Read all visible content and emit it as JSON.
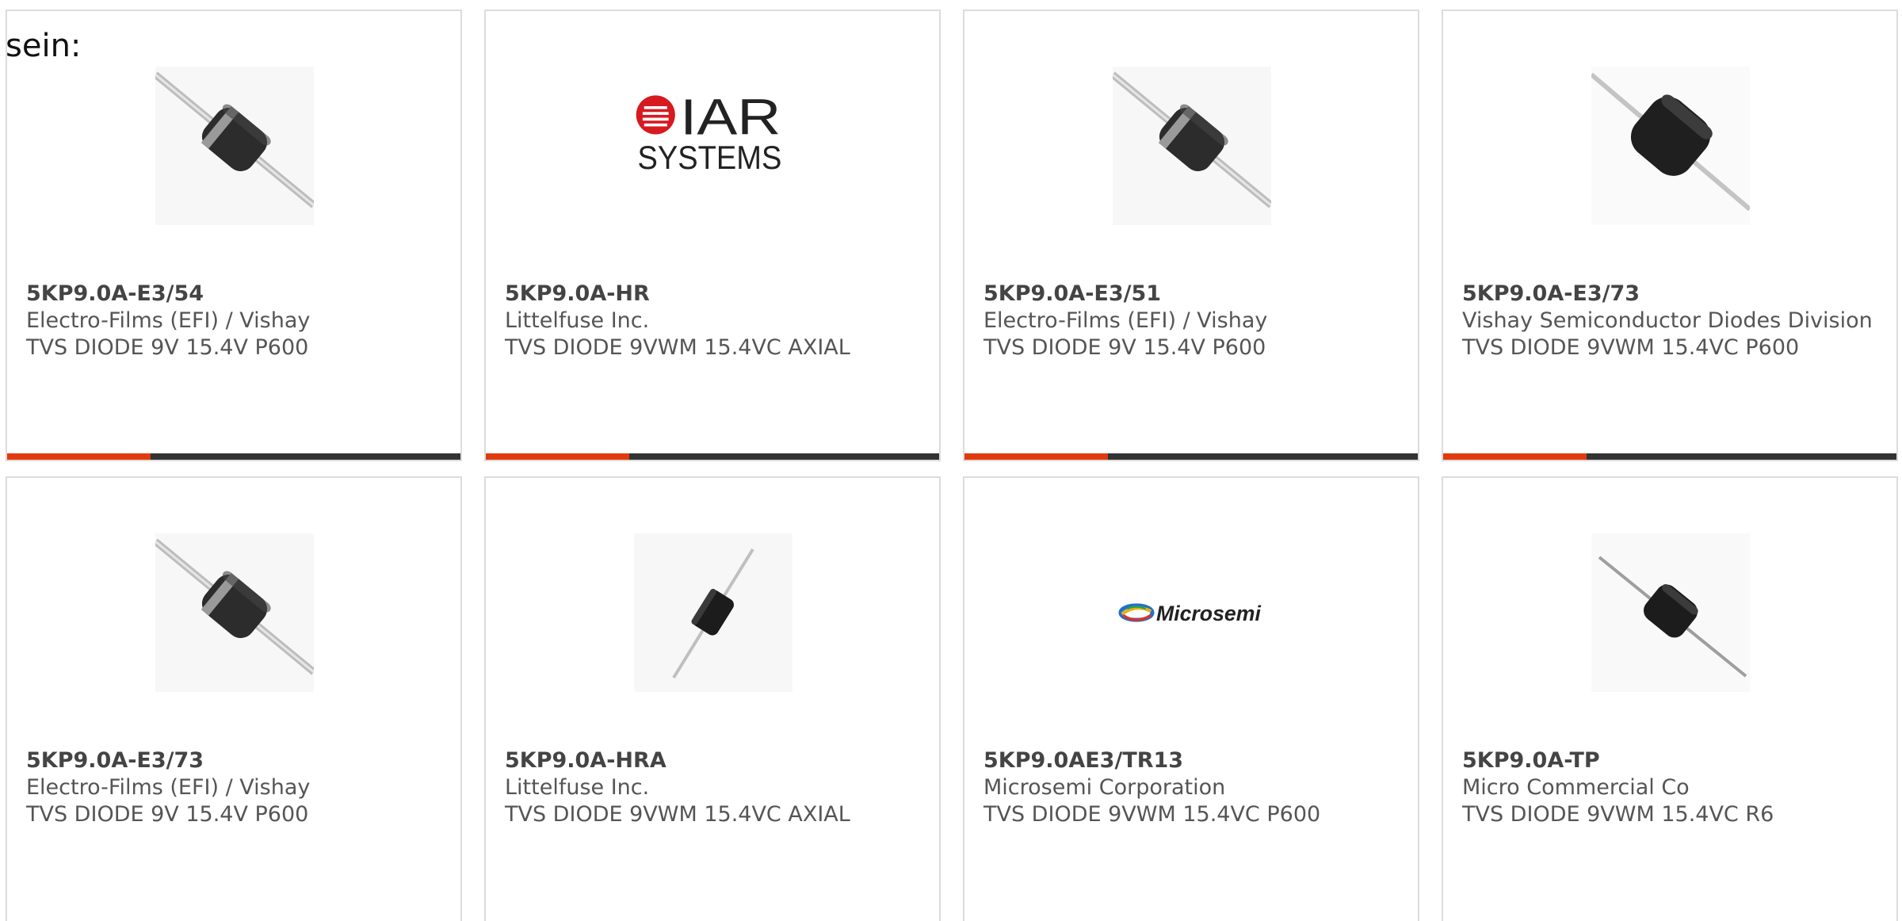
{
  "intro_text": "sein:",
  "colors": {
    "accent": "#e03a0f",
    "bar_dark": "#333333",
    "card_border": "#dcdcdc",
    "text_muted": "#555555"
  },
  "products": [
    {
      "part_number": "5KP9.0A-E3/54",
      "manufacturer": "Electro-Films (EFI) / Vishay",
      "description": "TVS DIODE 9V 15.4V P600",
      "image": "axial-diode-p600-icon"
    },
    {
      "part_number": "5KP9.0A-HR",
      "manufacturer": "Littelfuse Inc.",
      "description": "TVS DIODE 9VWM 15.4VC AXIAL",
      "image": "iar-systems-logo"
    },
    {
      "part_number": "5KP9.0A-E3/51",
      "manufacturer": "Electro-Films (EFI) / Vishay",
      "description": "TVS DIODE 9V 15.4V P600",
      "image": "axial-diode-p600-icon"
    },
    {
      "part_number": "5KP9.0A-E3/73",
      "manufacturer": "Vishay Semiconductor Diodes Division",
      "description": "TVS DIODE 9VWM 15.4VC P600",
      "image": "axial-diode-large-icon"
    },
    {
      "part_number": "5KP9.0A-E3/73",
      "manufacturer": "Electro-Films (EFI) / Vishay",
      "description": "TVS DIODE 9V 15.4V P600",
      "image": "axial-diode-p600-icon"
    },
    {
      "part_number": "5KP9.0A-HRA",
      "manufacturer": "Littelfuse Inc.",
      "description": "TVS DIODE 9VWM 15.4VC AXIAL",
      "image": "axial-diode-small-icon"
    },
    {
      "part_number": "5KP9.0AE3/TR13",
      "manufacturer": "Microsemi Corporation",
      "description": "TVS DIODE 9VWM 15.4VC P600",
      "image": "microsemi-logo"
    },
    {
      "part_number": "5KP9.0A-TP",
      "manufacturer": "Micro Commercial Co",
      "description": "TVS DIODE 9VWM 15.4VC R6",
      "image": "axial-diode-r6-icon"
    }
  ],
  "logos": {
    "iar_word": "IAR",
    "iar_sub": "SYSTEMS",
    "microsemi_word": "Microsemi"
  }
}
